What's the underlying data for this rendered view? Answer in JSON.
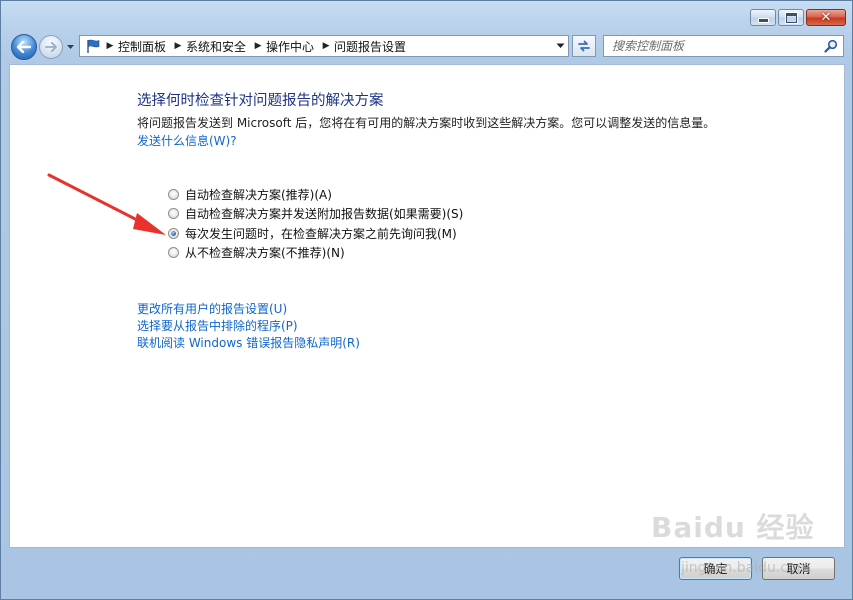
{
  "window": {
    "controls": [
      "minimize-icon",
      "maximize-icon",
      "close-icon"
    ]
  },
  "nav": {
    "breadcrumbs": [
      "控制面板",
      "系统和安全",
      "操作中心",
      "问题报告设置"
    ],
    "search_placeholder": "搜索控制面板"
  },
  "content": {
    "heading": "选择何时检查针对问题报告的解决方案",
    "description": "将问题报告发送到 Microsoft 后，您将在有可用的解决方案时收到这些解决方案。您可以调整发送的信息量。",
    "info_link": "发送什么信息(W)?",
    "options": [
      {
        "label": "自动检查解决方案(推荐)(A)",
        "checked": false
      },
      {
        "label": "自动检查解决方案并发送附加报告数据(如果需要)(S)",
        "checked": false
      },
      {
        "label": "每次发生问题时，在检查解决方案之前先询问我(M)",
        "checked": true
      },
      {
        "label": "从不检查解决方案(不推荐)(N)",
        "checked": false
      }
    ],
    "links": [
      "更改所有用户的报告设置(U)",
      "选择要从报告中排除的程序(P)",
      "联机阅读 Windows 错误报告隐私声明(R)"
    ]
  },
  "buttons": {
    "ok": "确定",
    "cancel": "取消"
  },
  "watermark": {
    "main": "Baidu 经验",
    "sub": "jingyan.baidu.com"
  },
  "colors": {
    "heading": "#1e3287",
    "link": "#0f66cc",
    "annotation_arrow": "#e8322b"
  }
}
